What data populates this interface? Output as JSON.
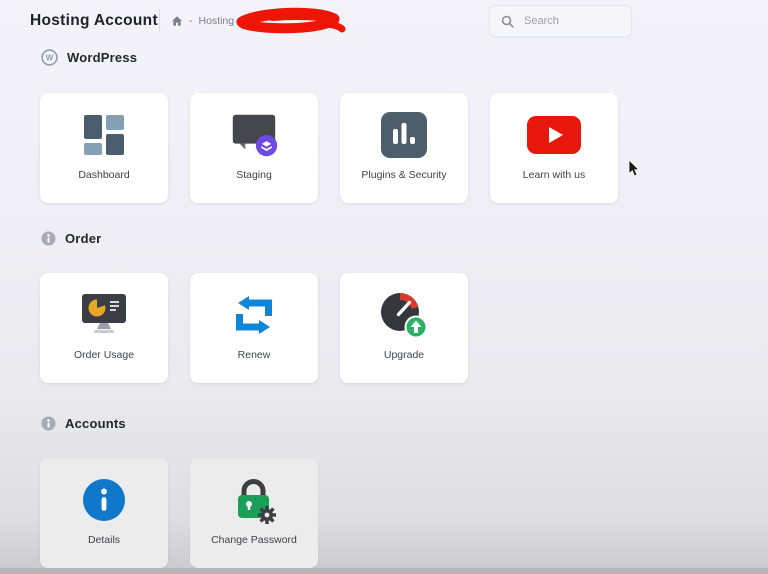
{
  "header": {
    "title": "Hosting Account",
    "breadcrumb": {
      "separator": "-",
      "item": "Hosting",
      "redacted": true
    },
    "search": {
      "placeholder": "Search"
    }
  },
  "sections": [
    {
      "label": "WordPress",
      "icon": "wordpress-logo",
      "cards": [
        {
          "label": "Dashboard",
          "icon": "dashboard-grid"
        },
        {
          "label": "Staging",
          "icon": "staging-monitor"
        },
        {
          "label": "Plugins & Security",
          "icon": "bar-chart"
        },
        {
          "label": "Learn with us",
          "icon": "youtube-play"
        }
      ]
    },
    {
      "label": "Order",
      "icon": "info-circle",
      "cards": [
        {
          "label": "Order Usage",
          "icon": "usage-monitor-pie"
        },
        {
          "label": "Renew",
          "icon": "renew-loop-arrows"
        },
        {
          "label": "Upgrade",
          "icon": "speedometer-up"
        }
      ]
    },
    {
      "label": "Accounts",
      "icon": "info-circle",
      "cards": [
        {
          "label": "Details",
          "icon": "info-circle-blue"
        },
        {
          "label": "Change Password",
          "icon": "lock-gear"
        }
      ]
    }
  ],
  "colors": {
    "redaction_red": "#ee1507",
    "youtube_red": "#e8170b",
    "staging_purple": "#6c4ae3",
    "renew_blue": "#0e86d7",
    "upgrade_green": "#2bb167",
    "details_blue": "#0f78ca",
    "lock_green": "#1b9e58",
    "slate_dark": "#4a5e70",
    "slate_light": "#84a0b4",
    "charcoal": "#3c3e43",
    "usage_yellow": "#e7a724"
  }
}
